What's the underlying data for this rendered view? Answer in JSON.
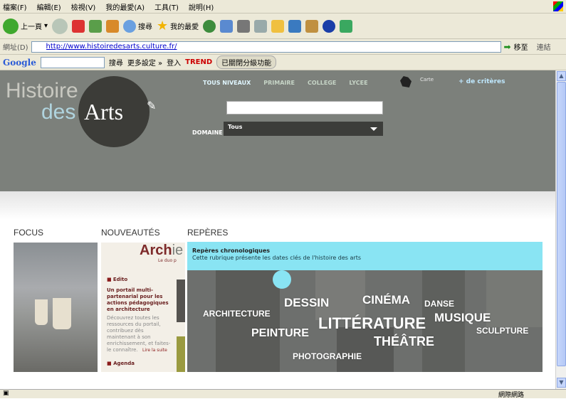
{
  "menu": [
    "檔案(F)",
    "編輯(E)",
    "檢視(V)",
    "我的最愛(A)",
    "工具(T)",
    "說明(H)"
  ],
  "toolbar": {
    "back": "上一頁",
    "search": "搜尋",
    "favorites": "我的最愛"
  },
  "address": {
    "label": "網址(D)",
    "url": "http://www.histoiredesarts.culture.fr/",
    "go": "移至",
    "links": "連結"
  },
  "google_bar": {
    "logo": "Google",
    "search": "搜尋",
    "more": "更多設定 »",
    "login": "登入",
    "trend": "TREND",
    "popup": "已關閉分級功能"
  },
  "site": {
    "logo": {
      "line1": "Histoire",
      "line2": "des",
      "line3": "Arts"
    },
    "levels": [
      "TOUS NIVEAUX",
      "PRIMAIRE",
      "COLLEGE",
      "LYCEE"
    ],
    "carte": "Carte",
    "criteres": "+ de critères",
    "domaine_label": "DOMAINE",
    "domaine_value": "Tous",
    "sections": {
      "focus": "FOCUS",
      "nouveautes": "NOUVEAUTÉS",
      "reperes": "REPÈRES"
    },
    "nouv": {
      "title_bold": "Arch",
      "title_rest": "ie",
      "duo": "Le duo p",
      "edito_head": "Edito",
      "edito_text": "Un portail multi-partenarial pour les actions pédagogiques en architecture",
      "edito_more": "Découvrez toutes les ressources du portail, contribuez dès maintenant à son enrichissement, et faites-le connaître.",
      "lire": "Lire la suite",
      "agenda": "Agenda"
    },
    "reperes": {
      "title": "Repères chronologiques",
      "subtitle": "Cette rubrique présente les dates clés de l'histoire des arts",
      "words": [
        "ARCHITECTURE",
        "DESSIN",
        "CINÉMA",
        "DANSE",
        "MUSIQUE",
        "PEINTURE",
        "LITTÉRATURE",
        "SCULPTURE",
        "THÉÂTRE",
        "PHOTOGRAPHIE"
      ]
    }
  },
  "status": {
    "zone": "網際網路"
  }
}
